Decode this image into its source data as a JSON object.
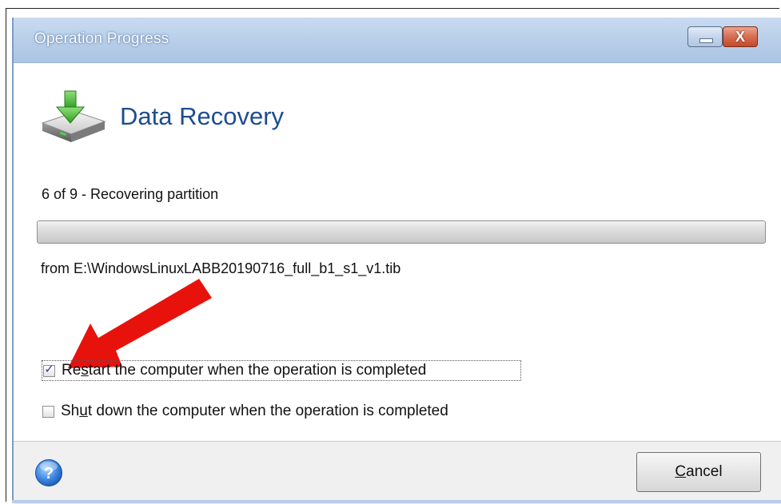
{
  "window": {
    "title": "Operation Progress",
    "minimize_glyph": "",
    "close_glyph": "X"
  },
  "header": {
    "icon": "disk-download-icon",
    "title": "Data Recovery"
  },
  "progress": {
    "step_text": "6 of 9 - Recovering partition",
    "fraction": 0.0,
    "source_text": "from E:\\WindowsLinuxLABB20190716_full_b1_s1_v1.tib"
  },
  "options": [
    {
      "label_prefix": "Re",
      "label_mnemonic": "s",
      "label_suffix": "tart the computer when the operation is completed",
      "checked": true
    },
    {
      "label_prefix": "Sh",
      "label_mnemonic": "u",
      "label_suffix": "t down the computer when the operation is completed",
      "checked": false
    }
  ],
  "annotation": {
    "arrow_color": "#e8120c"
  },
  "footer": {
    "help_icon": "help-icon",
    "cancel_mnemonic": "C",
    "cancel_rest": "ancel"
  },
  "colors": {
    "title_accent": "#1d4d8f",
    "titlebar": "#b9cfe9",
    "close_button": "#d86d51"
  }
}
